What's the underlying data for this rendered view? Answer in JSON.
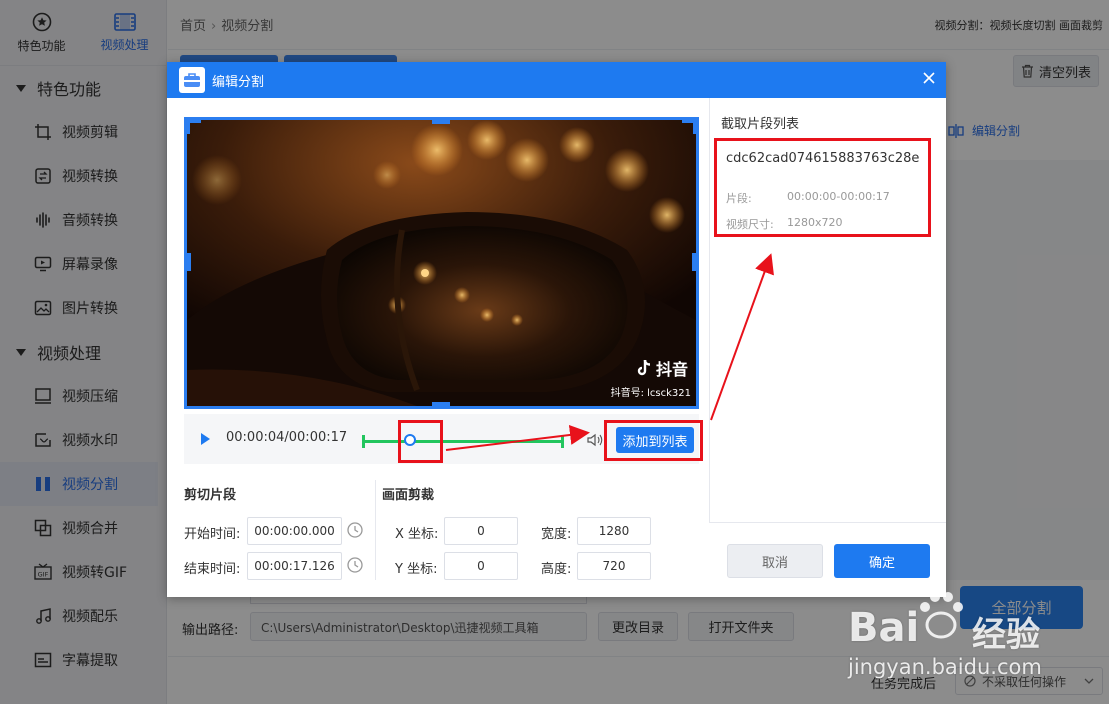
{
  "sidebar": {
    "top_nav": [
      {
        "label": "特色功能",
        "icon": "star-icon"
      },
      {
        "label": "视频处理",
        "icon": "film-icon"
      }
    ],
    "section_featured": "特色功能",
    "featured_items": [
      {
        "label": "视频剪辑",
        "icon": "crop-icon"
      },
      {
        "label": "视频转换",
        "icon": "convert-icon"
      },
      {
        "label": "音频转换",
        "icon": "audio-wave-icon"
      },
      {
        "label": "屏幕录像",
        "icon": "screen-record-icon"
      },
      {
        "label": "图片转换",
        "icon": "image-icon"
      }
    ],
    "section_video": "视频处理",
    "video_items": [
      {
        "label": "视频压缩",
        "icon": "compress-icon"
      },
      {
        "label": "视频水印",
        "icon": "watermark-icon"
      },
      {
        "label": "视频分割",
        "icon": "split-icon",
        "active": true
      },
      {
        "label": "视频合并",
        "icon": "merge-icon"
      },
      {
        "label": "视频转GIF",
        "icon": "gif-icon"
      },
      {
        "label": "视频配乐",
        "icon": "music-icon"
      },
      {
        "label": "字幕提取",
        "icon": "subtitle-icon"
      }
    ]
  },
  "header": {
    "breadcrumb_home": "首页",
    "breadcrumb_sep": "›",
    "breadcrumb_current": "视频分割",
    "description": "视频分割：视频长度切割 画面裁剪"
  },
  "background": {
    "clear_list": "清空列表",
    "edit_split": "编辑分割",
    "split_all": "全部分割",
    "output_label": "输出路径:",
    "output_path": "C:\\Users\\Administrator\\Desktop\\迅捷视频工具箱",
    "change_dir": "更改目录",
    "open_folder": "打开文件夹",
    "after_task_label": "任务完成后",
    "after_task_value": "不采取任何操作"
  },
  "dialog": {
    "title": "编辑分割",
    "video_brand": "抖音",
    "video_id": "抖音号: lcsck321",
    "time_display": "00:00:04/00:00:17",
    "add_to_list": "添加到列表",
    "cut_section": "剪切片段",
    "start_label": "开始时间:",
    "start_value": "00:00:00.000",
    "end_label": "结束时间:",
    "end_value": "00:00:17.126",
    "crop_section": "画面剪裁",
    "x_label": "X 坐标:",
    "x_value": "0",
    "y_label": "Y 坐标:",
    "y_value": "0",
    "w_label": "宽度:",
    "w_value": "1280",
    "h_label": "高度:",
    "h_value": "720",
    "clip_list_title": "截取片段列表",
    "clip": {
      "name": "cdc62cad074615883763c28e",
      "segment_label": "片段:",
      "segment_value": "00:00:00-00:00:17",
      "size_label": "视频尺寸:",
      "size_value": "1280x720"
    },
    "cancel": "取消",
    "confirm": "确定",
    "playhead_fraction": 0.24
  },
  "watermark": {
    "brand": "Bai",
    "brand_cn": "经验",
    "url": "jingyan.baidu.com"
  },
  "colors": {
    "accent": "#1e7af0",
    "annotation": "#e8121b",
    "trim_track": "#22c55e"
  }
}
